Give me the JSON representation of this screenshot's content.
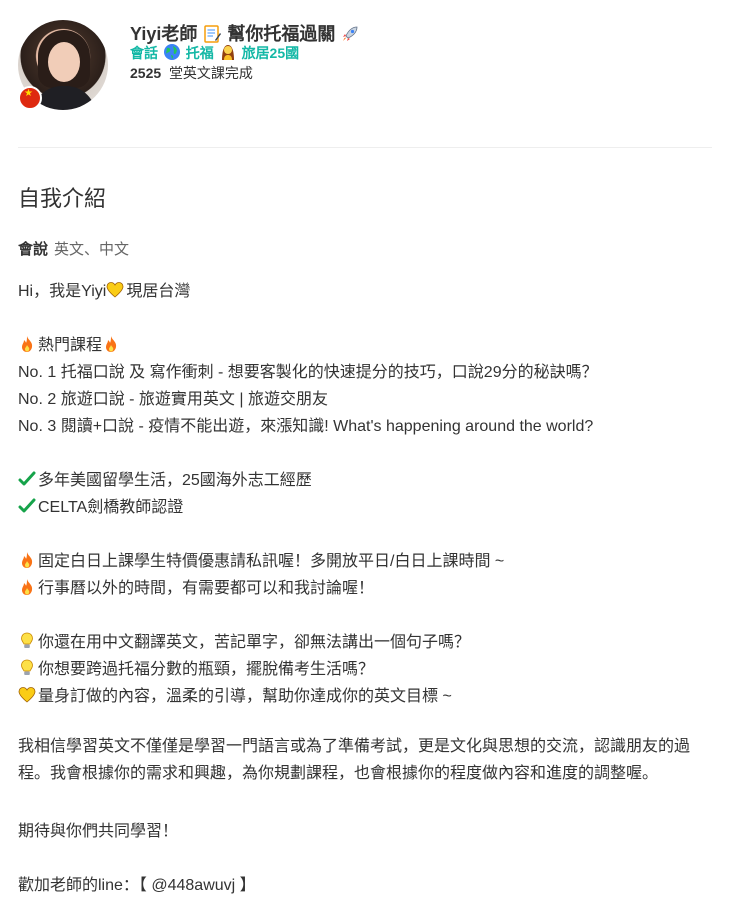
{
  "profile": {
    "name_prefix": "Yiyi老師",
    "name_suffix": "幫你托福過關",
    "tag_a": "會話",
    "tag_b": "托福",
    "tag_c": "旅居25國",
    "lessons_count": "2525",
    "lessons_text": "堂英文課完成"
  },
  "about": {
    "title": "自我介紹",
    "speaks_label": "會說",
    "speaks_value": "英文、中文",
    "greeting": "Hi，我是Yiyi",
    "greeting_tail": "現居台灣",
    "hot_courses": "熱門課程",
    "course1": "No. 1  托福口說 及 寫作衝刺 - 想要客製化的快速提分的技巧，口說29分的秘訣嗎？",
    "course2": "No. 2  旅遊口說 - 旅遊實用英文 | 旅遊交朋友",
    "course3": "No. 3  閱讀+口說 - 疫情不能出遊，來漲知識! What's happening around the world?",
    "exp1": "多年美國留學生活，25國海外志工經歷",
    "exp2": "CELTA劍橋教師認證",
    "note1": "固定白日上課學生特價優惠請私訊喔！多開放平日/白日上課時間 ~",
    "note2": "行事曆以外的時間，有需要都可以和我討論喔！",
    "q1": "你還在用中文翻譯英文，苦記單字，卻無法講出一個句子嗎？",
    "q2": "你想要跨過托福分數的瓶頸，擺脫備考生活嗎？",
    "q3": "量身訂做的內容，溫柔的引導，幫助你達成你的英文目標 ~",
    "paragraph": "我相信學習英文不僅僅是學習一門語言或為了準備考試，更是文化與思想的交流，認識朋友的過程。我會根據你的需求和興趣，為你規劃課程，也會根據你的程度做內容和進度的調整喔。",
    "closing": "期待與你們共同學習！",
    "line_label": "歡加老師的line：【 @448awuvj 】"
  },
  "icons": {
    "memo": "memo-icon",
    "rocket": "rocket-icon",
    "globe": "globe-icon",
    "woman": "woman-icon",
    "heart": "yellow-heart-icon",
    "fire": "fire-icon",
    "ribbon": "ribbon-icon",
    "check": "check-icon",
    "bulb": "bulb-icon",
    "flag": "china-flag-icon"
  },
  "colors": {
    "accent": "#14b8a6",
    "text": "#333333",
    "fire": "#f97316",
    "check": "#16a34a"
  }
}
